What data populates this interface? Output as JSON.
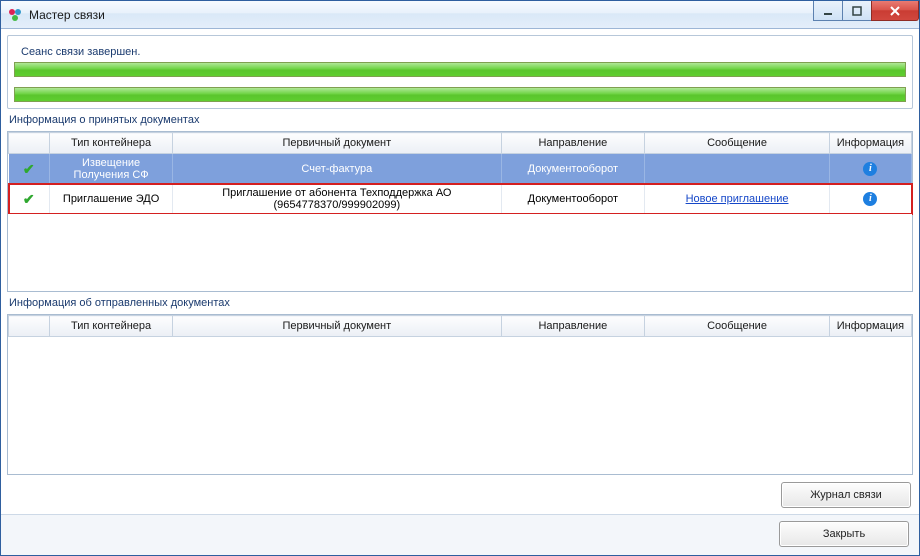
{
  "window": {
    "title": "Мастер связи"
  },
  "status": {
    "session_text": "Сеанс связи завершен."
  },
  "received": {
    "section_label": "Информация о принятых документах",
    "columns": {
      "status": "",
      "type": "Тип контейнера",
      "primary": "Первичный документ",
      "direction": "Направление",
      "message": "Сообщение",
      "info": "Информация"
    },
    "rows": [
      {
        "ok": true,
        "type": "Извещение Получения СФ",
        "primary": "Счет-фактура",
        "direction": "Документооборот",
        "message": "",
        "info": true,
        "selected": true,
        "highlight": false
      },
      {
        "ok": true,
        "type": "Приглашение ЭДО",
        "primary": "Приглашение от абонента Техподдержка АО (9654778370/999902099)",
        "direction": "Документооборот",
        "message": "Новое приглашение",
        "message_is_link": true,
        "info": true,
        "selected": false,
        "highlight": true
      }
    ]
  },
  "sent": {
    "section_label": "Информация об отправленных документах",
    "columns": {
      "status": "",
      "type": "Тип контейнера",
      "primary": "Первичный документ",
      "direction": "Направление",
      "message": "Сообщение",
      "info": "Информация"
    },
    "rows": []
  },
  "buttons": {
    "journal": "Журнал связи",
    "close": "Закрыть"
  }
}
